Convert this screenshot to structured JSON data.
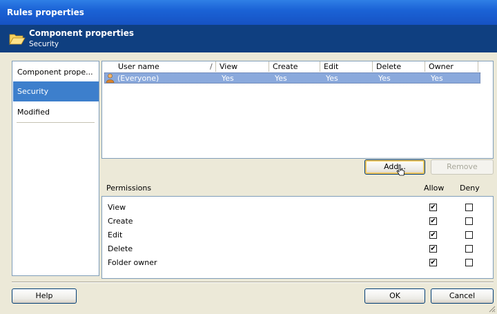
{
  "window": {
    "title": "Rules properties"
  },
  "header": {
    "title": "Component properties",
    "subtitle": "Security"
  },
  "sidebar": {
    "items": [
      {
        "label": "Component prope...",
        "selected": false
      },
      {
        "label": "Security",
        "selected": true
      },
      {
        "label": "Modified",
        "selected": false
      }
    ]
  },
  "user_table": {
    "columns": [
      "User name",
      "View",
      "Create",
      "Edit",
      "Delete",
      "Owner"
    ],
    "sort_indicator": "/",
    "rows": [
      {
        "user": "(Everyone)",
        "view": "Yes",
        "create": "Yes",
        "edit": "Yes",
        "delete": "Yes",
        "owner": "Yes"
      }
    ]
  },
  "buttons": {
    "add": "Add...",
    "remove": "Remove",
    "help": "Help",
    "ok": "OK",
    "cancel": "Cancel"
  },
  "permissions": {
    "heading": "Permissions",
    "allow_label": "Allow",
    "deny_label": "Deny",
    "items": [
      {
        "label": "View",
        "allow": true,
        "deny": false
      },
      {
        "label": "Create",
        "allow": true,
        "deny": false
      },
      {
        "label": "Edit",
        "allow": true,
        "deny": false
      },
      {
        "label": "Delete",
        "allow": true,
        "deny": false
      },
      {
        "label": "Folder owner",
        "allow": true,
        "deny": false
      }
    ]
  },
  "colors": {
    "title_bar": "#1b63d6",
    "header_bg": "#0f3f80",
    "selection": "#3d7fcc",
    "dialog_bg": "#ece9d8"
  }
}
